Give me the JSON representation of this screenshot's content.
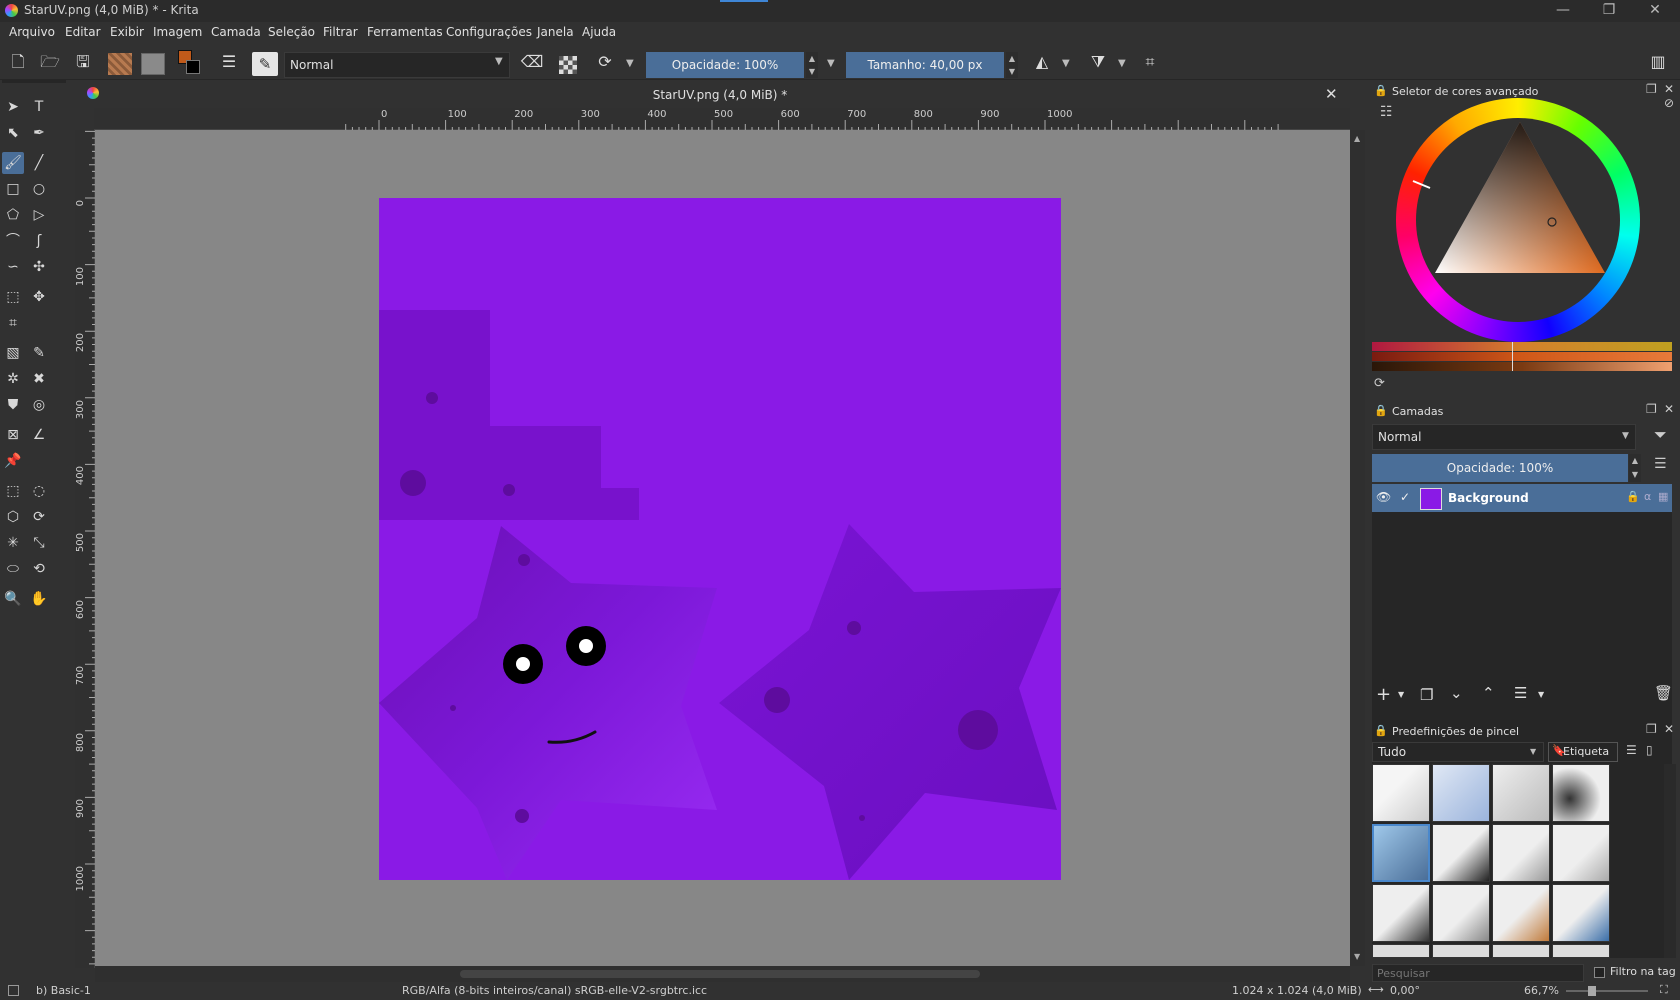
{
  "window": {
    "title": "StarUV.png (4,0 MiB) * - Krita",
    "minimize": "—",
    "restore": "❐",
    "close": "✕"
  },
  "menu": [
    "Arquivo",
    "Editar",
    "Exibir",
    "Imagem",
    "Camada",
    "Seleção",
    "Filtrar",
    "Ferramentas",
    "Configurações",
    "Janela",
    "Ajuda"
  ],
  "toolbar": {
    "blend_mode": "Normal",
    "opacity": "Opacidade: 100%",
    "size": "Tamanho: 40,00 px"
  },
  "document": {
    "tab_title": "StarUV.png (4,0 MiB) *",
    "close": "✕"
  },
  "ruler": {
    "h_labels": [
      "0",
      "100",
      "200",
      "300",
      "400",
      "500",
      "600",
      "700",
      "800",
      "900",
      "1000"
    ],
    "v_labels": [
      "0",
      "100",
      "200",
      "300",
      "400",
      "500",
      "600",
      "700",
      "800",
      "900",
      "1000"
    ]
  },
  "color_selector": {
    "title": "Seletor de cores avançado",
    "color_hex": "#e06a1e"
  },
  "layers": {
    "title": "Camadas",
    "blend_mode": "Normal",
    "opacity": "Opacidade:  100%",
    "items": [
      {
        "name": "Background",
        "visible": true,
        "selected": true
      }
    ]
  },
  "brush_presets": {
    "title": "Predefinições de pincel",
    "filter": "Tudo",
    "tag_button": "Etiqueta",
    "search_placeholder": "Pesquisar",
    "tag_filter_label": "Filtro na tag"
  },
  "status": {
    "brush": "b) Basic-1",
    "color_space": "RGB/Alfa (8-bits inteiros/canal)  sRGB-elle-V2-srgbtrc.icc",
    "image_size": "1.024 x 1.024 (4,0 MiB)",
    "rotation": "0,00°",
    "zoom": "66,7%"
  },
  "colors": {
    "canvas_purple": "#8a1ae6",
    "accent_blue": "#4a6e98",
    "fg_color": "#c05a1a"
  }
}
